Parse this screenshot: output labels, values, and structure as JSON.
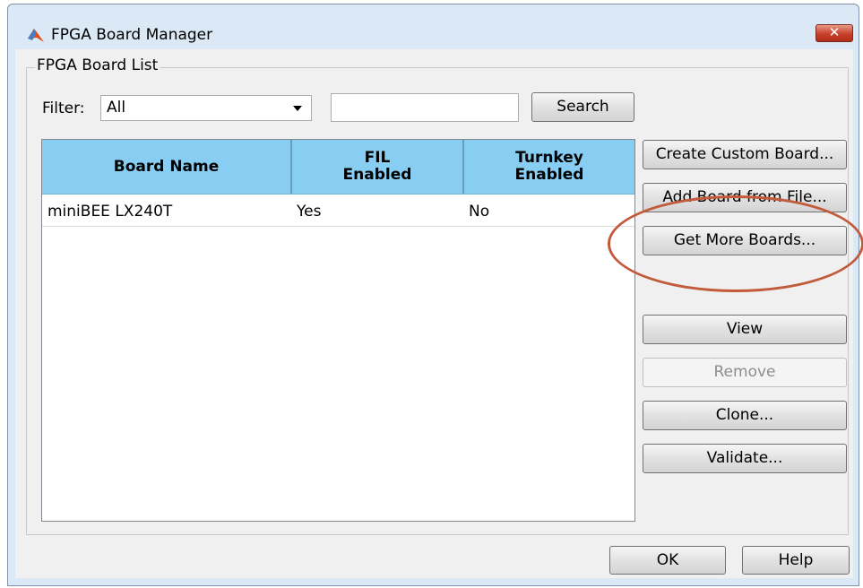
{
  "window": {
    "title": "FPGA Board Manager",
    "close_label": "✕"
  },
  "group": {
    "title": "FPGA Board List"
  },
  "filter": {
    "label": "Filter:",
    "selected": "All",
    "search_value": "",
    "search_button": "Search"
  },
  "table": {
    "columns": [
      {
        "line1": "Board Name",
        "line2": ""
      },
      {
        "line1": "FIL",
        "line2": "Enabled"
      },
      {
        "line1": "Turnkey",
        "line2": "Enabled"
      }
    ],
    "rows": [
      {
        "board_name": "miniBEE LX240T",
        "fil_enabled": "Yes",
        "turnkey_enabled": "No"
      }
    ]
  },
  "side_buttons": {
    "create_custom": "Create Custom Board...",
    "add_from_file": "Add Board from File...",
    "get_more": "Get More Boards...",
    "view": "View",
    "remove": "Remove",
    "clone": "Clone...",
    "validate": "Validate..."
  },
  "footer": {
    "ok": "OK",
    "help": "Help"
  },
  "colors": {
    "header_bg": "#87cef2",
    "annotation": "#c25a3c",
    "window_frame": "#dbe8f5"
  }
}
